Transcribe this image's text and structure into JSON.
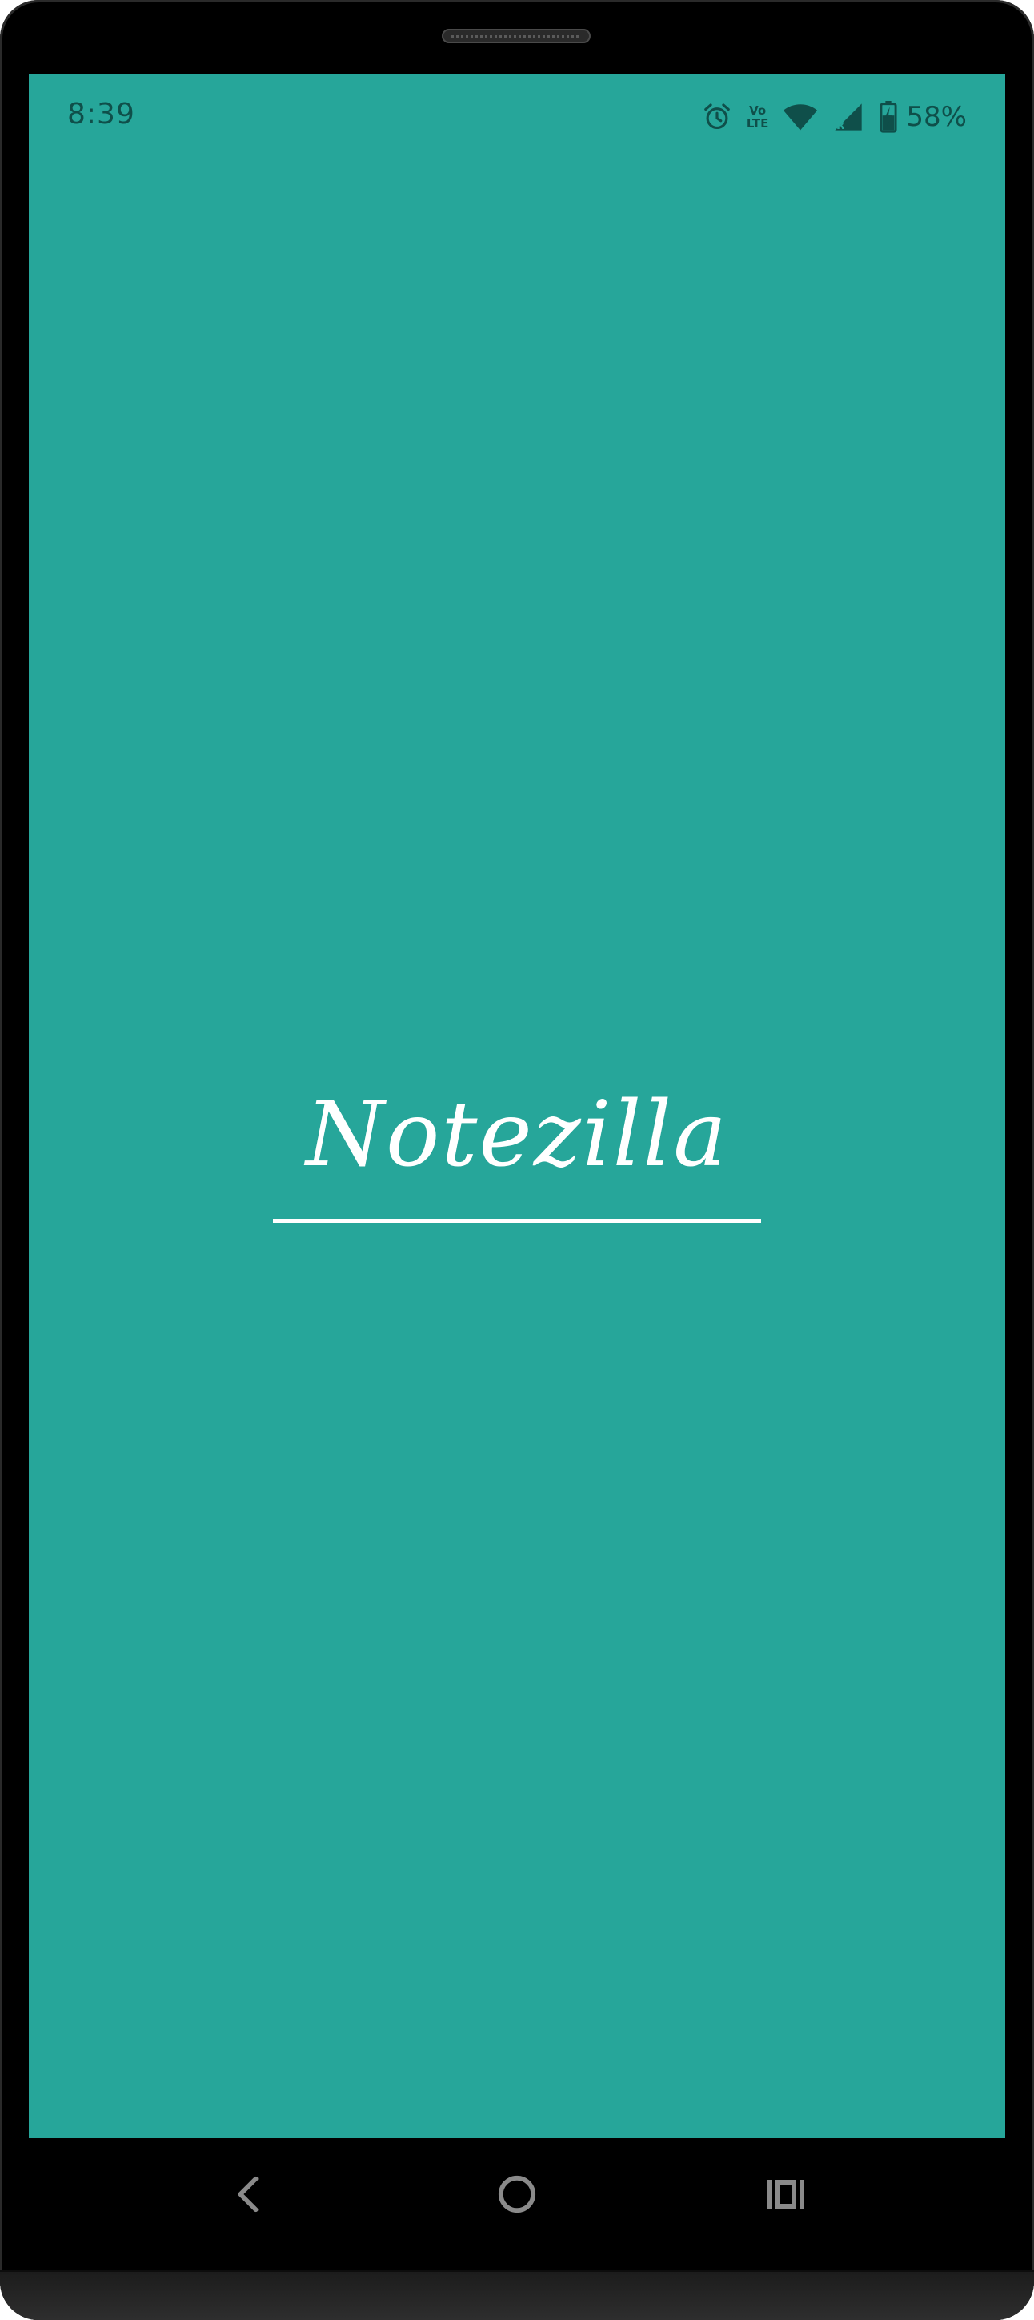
{
  "status_bar": {
    "time": "8:39",
    "battery_percent": "58%",
    "volte_top": "Vo",
    "volte_bottom": "LTE",
    "icons": [
      "alarm-icon",
      "volte-icon",
      "wifi-icon",
      "cell-signal-icon",
      "battery-charging-icon"
    ]
  },
  "splash": {
    "app_name": "Notezilla"
  },
  "navigation": {
    "buttons": [
      "back-icon",
      "home-icon",
      "recents-icon"
    ]
  },
  "colors": {
    "screen_background": "#26a69a",
    "status_foreground": "#0f4f4a",
    "title_color": "#ffffff",
    "nav_icon_color": "#8a8a8a"
  }
}
